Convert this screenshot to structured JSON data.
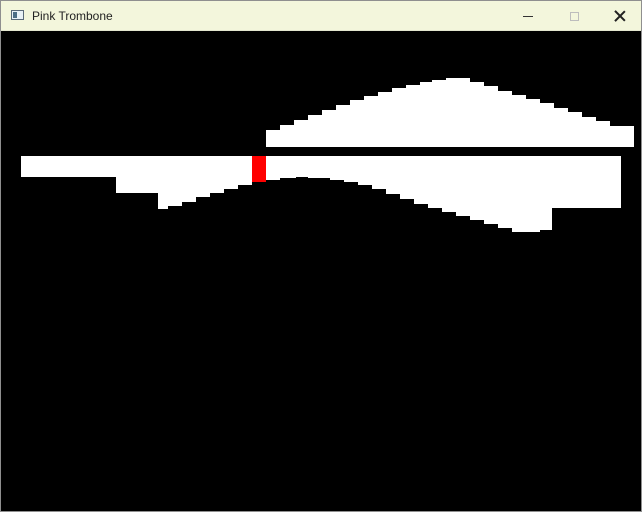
{
  "window": {
    "title": "Pink Trombone",
    "icons": {
      "app": "app-window-icon",
      "minimize": "minimize-icon",
      "maximize": "maximize-icon",
      "close": "close-icon"
    },
    "colors": {
      "titlebar_background": "#f3f6dc",
      "canvas_background": "#000000",
      "tract_fill": "#ffffff",
      "marker_fill": "#ff0000"
    }
  }
}
